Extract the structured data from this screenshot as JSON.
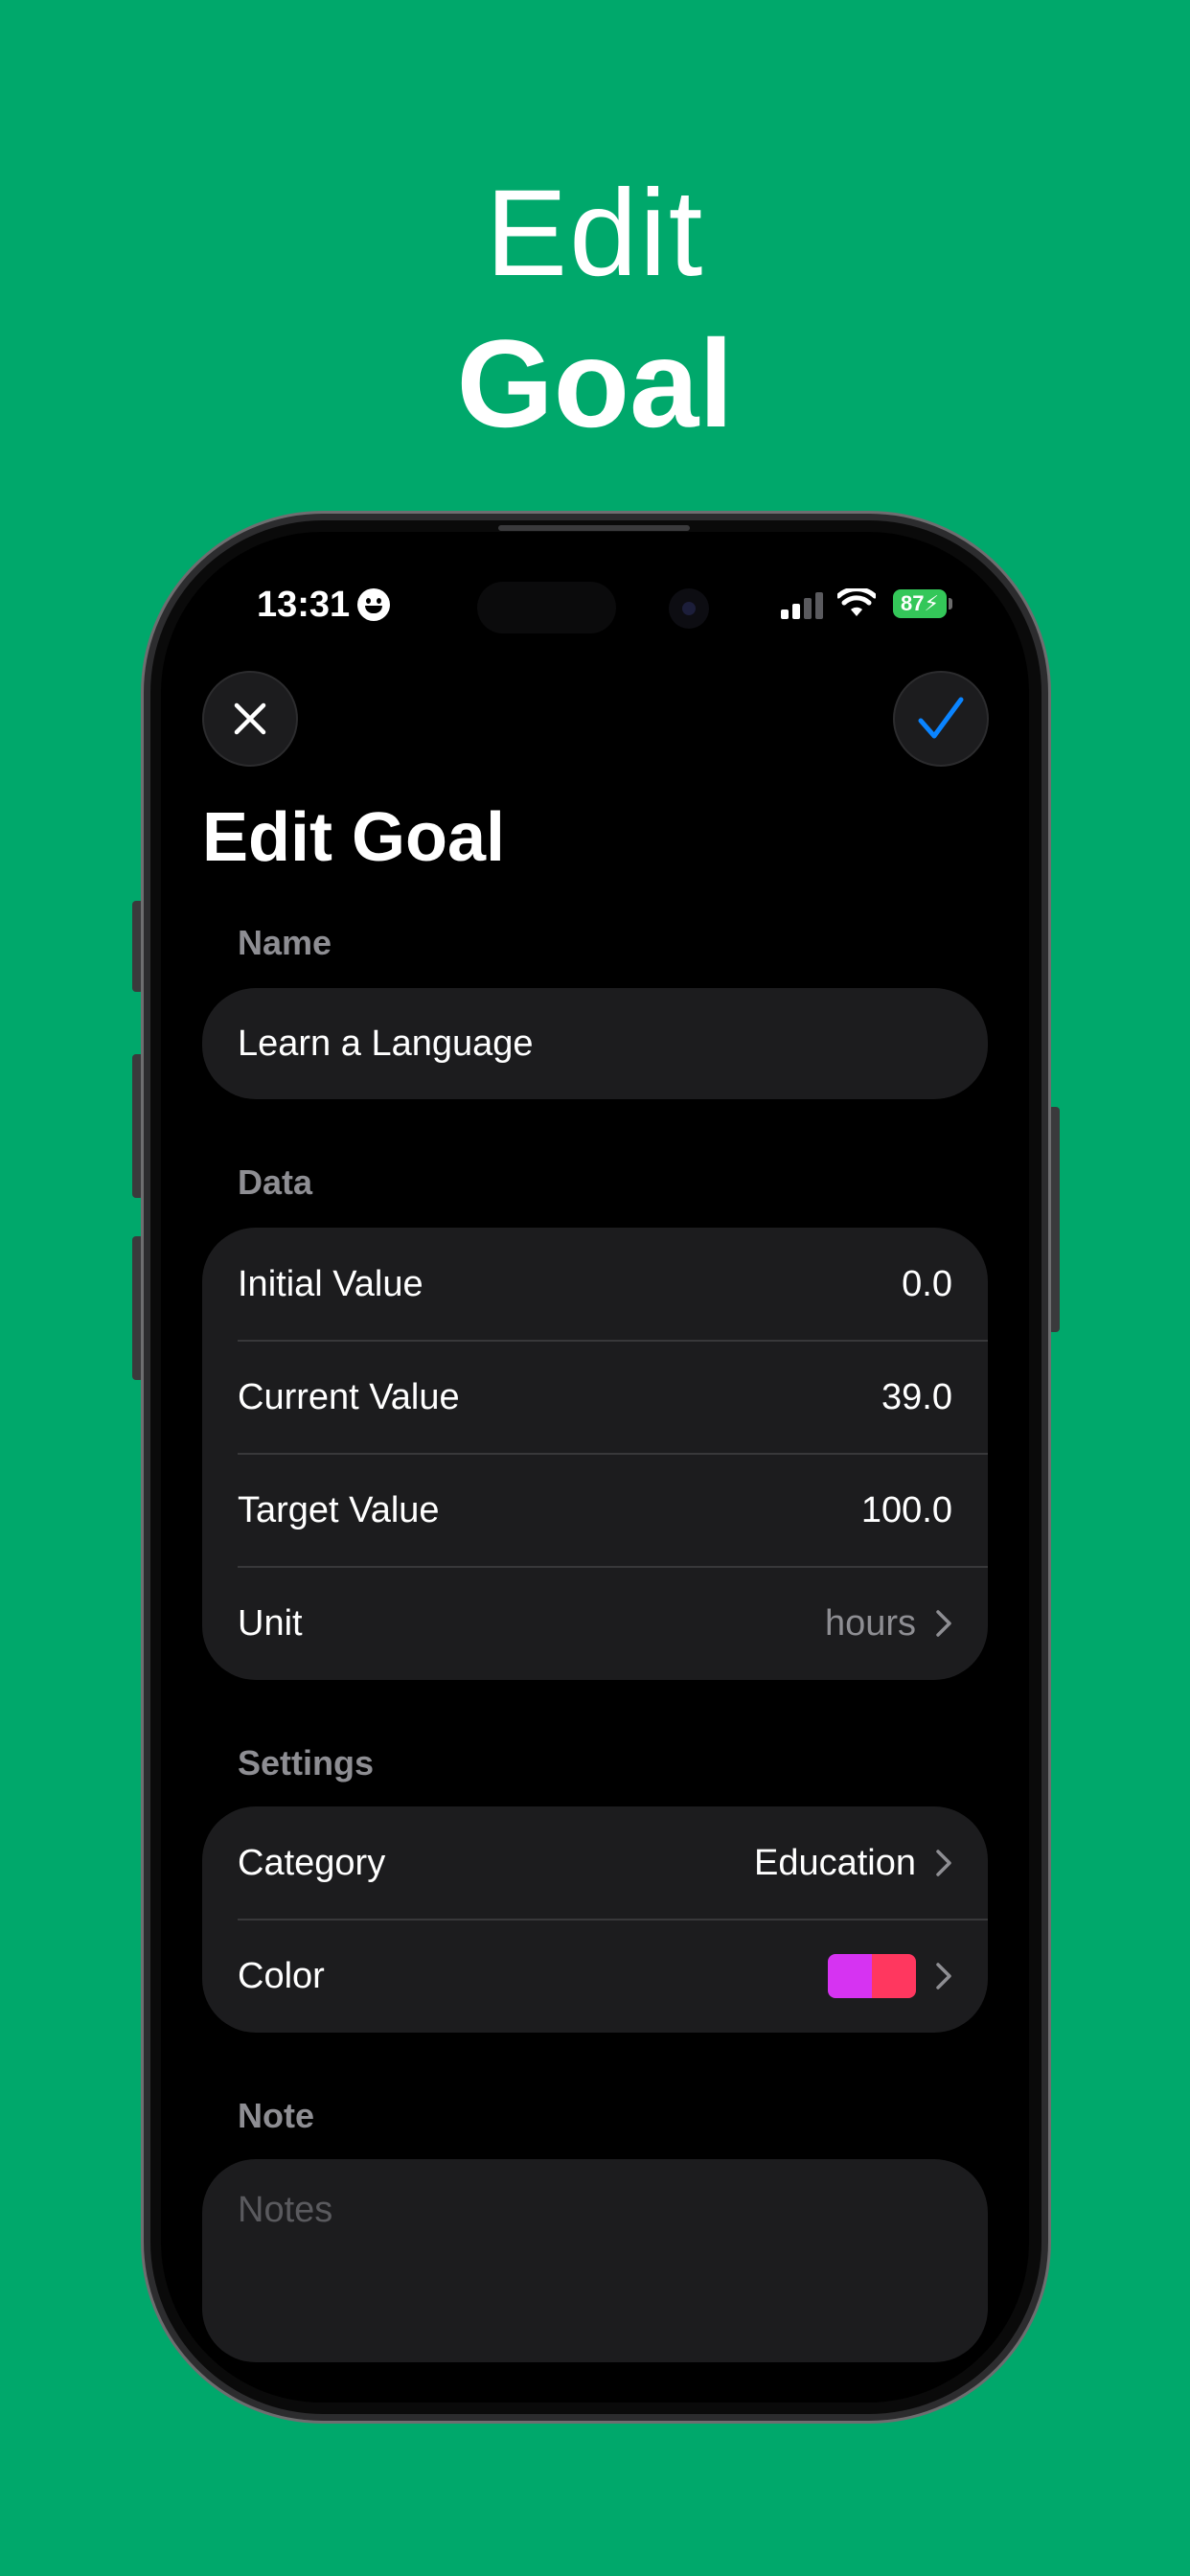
{
  "headline": {
    "line1": "Edit",
    "line2": "Goal"
  },
  "status_bar": {
    "time": "13:31",
    "battery": "87"
  },
  "nav": {
    "close_icon": "close-icon",
    "confirm_icon": "checkmark-icon",
    "confirm_color": "#0a84ff"
  },
  "page_title": "Edit Goal",
  "sections": {
    "name": {
      "label": "Name",
      "value": "Learn a Language"
    },
    "data": {
      "label": "Data",
      "rows": [
        {
          "label": "Initial Value",
          "value": "0.0"
        },
        {
          "label": "Current Value",
          "value": "39.0"
        },
        {
          "label": "Target Value",
          "value": "100.0"
        },
        {
          "label": "Unit",
          "value": "hours"
        }
      ]
    },
    "settings": {
      "label": "Settings",
      "category": {
        "label": "Category",
        "value": "Education"
      },
      "color": {
        "label": "Color",
        "swatch_left": "#d633f2",
        "swatch_right": "#ff375f"
      }
    },
    "note": {
      "label": "Note",
      "placeholder": "Notes"
    }
  },
  "colors": {
    "background": "#00a86b",
    "card": "#1c1c1e",
    "muted": "#8e8e93",
    "battery": "#34c759"
  }
}
